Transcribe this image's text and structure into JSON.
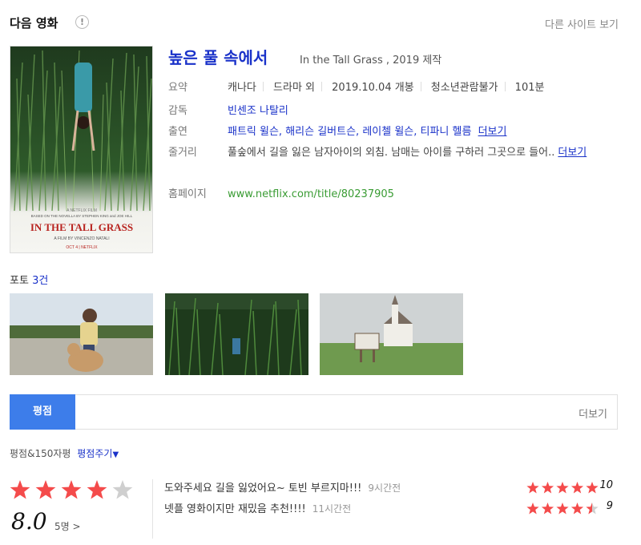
{
  "header": {
    "title": "다음 영화",
    "info_icon": "!",
    "other_site": "다른 사이트 보기"
  },
  "movie": {
    "title": "높은 풀 속에서",
    "original_title": "In the Tall Grass",
    "year_text": "2019 제작",
    "poster_text": {
      "tagline": "A NETFLIX FILM",
      "credit": "BASED ON THE NOVELLA BY STEPHEN KING and JOE HILL",
      "title": "IN THE TALL GRASS",
      "director": "A FILM BY VINCENZO NATALI",
      "release": "OCT 4 | NETFLIX"
    }
  },
  "info": {
    "summary_label": "요약",
    "summary": [
      "캐나다",
      "드라마 외",
      "2019.10.04 개봉",
      "청소년관람불가",
      "101분"
    ],
    "director_label": "감독",
    "director": "빈센조 나탈리",
    "cast_label": "출연",
    "cast": "패트릭 윌슨, 해리슨 길버트슨, 레이첼 윌슨, 티파니 헬름",
    "cast_more": "더보기",
    "plot_label": "줄거리",
    "plot": "풀숲에서 길을 잃은 남자아이의 외침. 남매는 아이를 구하러 그곳으로 들어..",
    "plot_more": "더보기",
    "homepage_label": "홈페이지",
    "homepage": "www.netflix.com/title/80237905"
  },
  "photos": {
    "label": "포토",
    "count": "3건"
  },
  "rating": {
    "tab": "평점",
    "more": "더보기",
    "sub_label": "평점&150자평",
    "give": "평점주기",
    "score": "8.0",
    "stars": 4,
    "voters": "5명 >",
    "reviews": [
      {
        "text": "도와주세요 길을 잃었어요~ 토빈 부르지마!!!",
        "time": "9시간전",
        "score": "10",
        "stars": 5
      },
      {
        "text": "넷플 영화이지만 재밌음 추천!!!!",
        "time": "11시간전",
        "score": "9",
        "stars": 4.5
      }
    ]
  },
  "colors": {
    "accent_blue": "#1a32c9",
    "tab_blue": "#3d7dea",
    "star_red": "#f44b4b",
    "link_green": "#3a9c34"
  }
}
